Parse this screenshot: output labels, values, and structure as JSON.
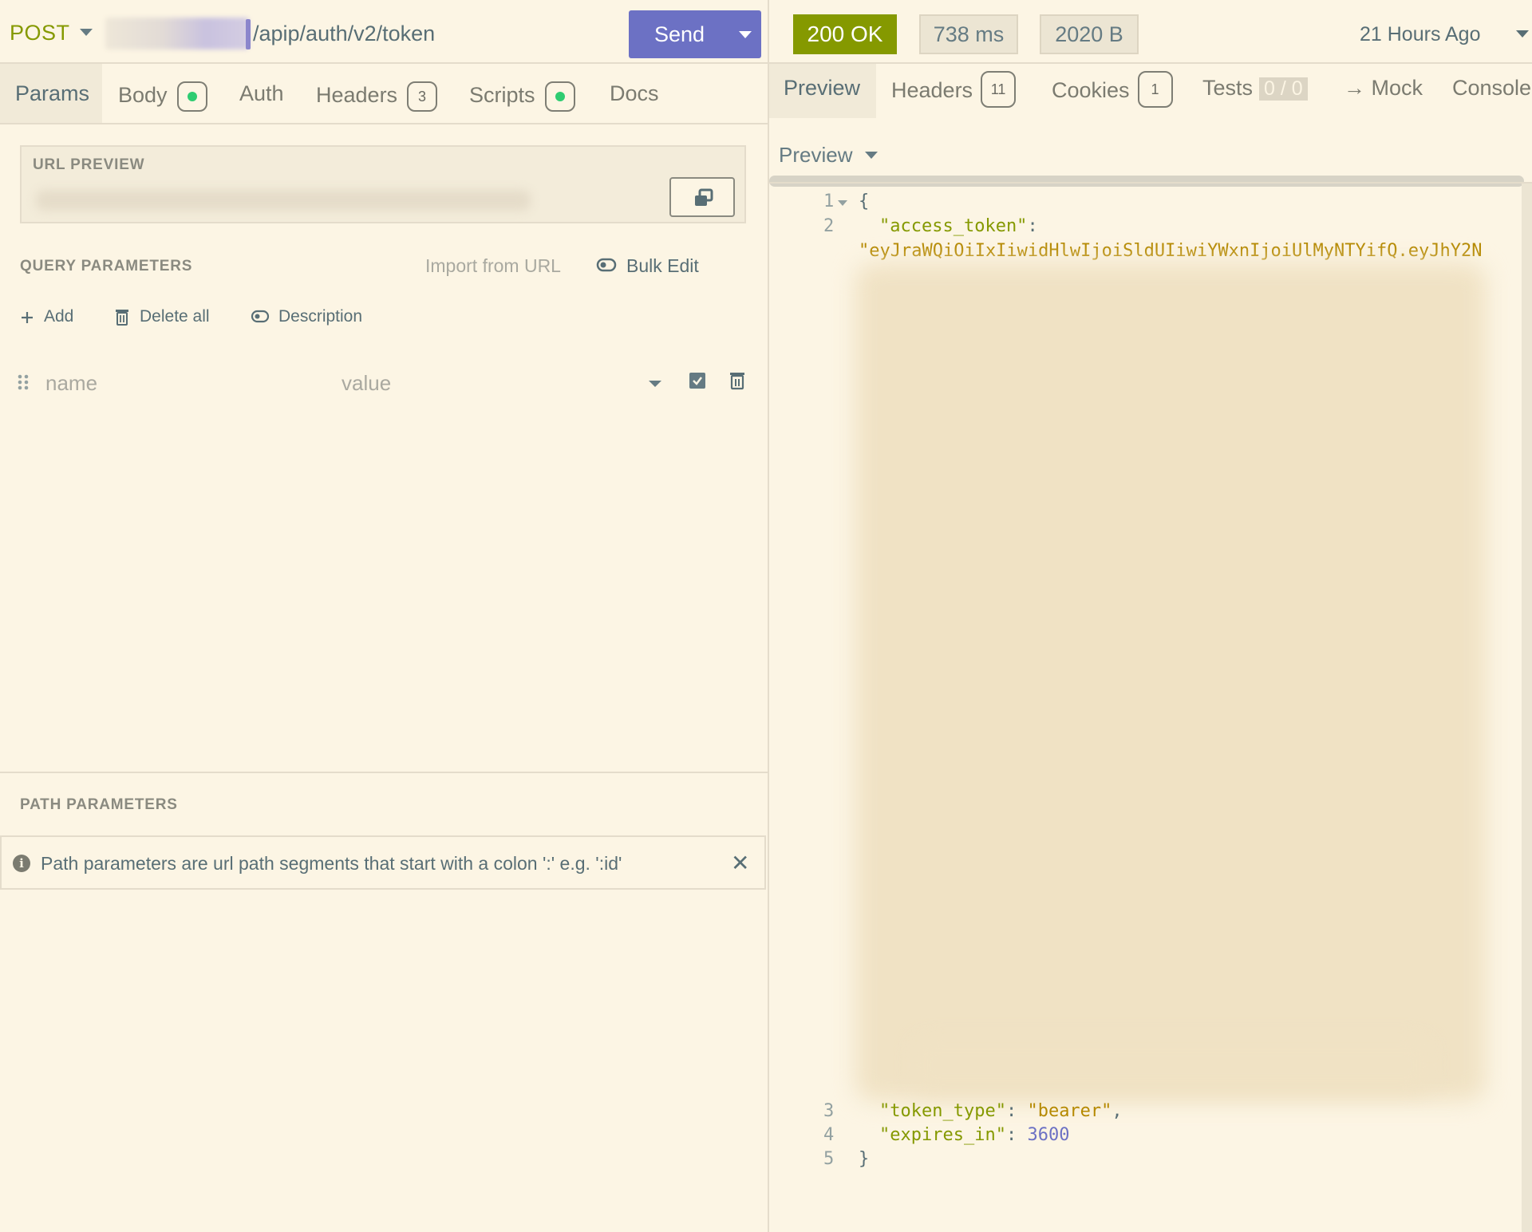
{
  "request": {
    "method": "POST",
    "url_path": "/apip/auth/v2/token",
    "send_label": "Send",
    "tabs": [
      {
        "label": "Params"
      },
      {
        "label": "Body"
      },
      {
        "label": "Auth"
      },
      {
        "label": "Headers",
        "badge": "3"
      },
      {
        "label": "Scripts"
      },
      {
        "label": "Docs"
      }
    ],
    "url_preview_label": "URL PREVIEW",
    "query_params_label": "QUERY PARAMETERS",
    "import_from_url": "Import from URL",
    "bulk_edit": "Bulk Edit",
    "actions": {
      "add": "Add",
      "delete_all": "Delete all",
      "description": "Description"
    },
    "param_row": {
      "name_placeholder": "name",
      "value_placeholder": "value"
    },
    "path_params_label": "PATH PARAMETERS",
    "path_params_info": "Path parameters are url path segments that start with a colon ':' e.g. ':id'"
  },
  "response": {
    "status": "200 OK",
    "time": "738 ms",
    "size": "2020 B",
    "time_ago": "21 Hours Ago",
    "tabs": [
      {
        "label": "Preview"
      },
      {
        "label": "Headers",
        "badge": "11"
      },
      {
        "label": "Cookies",
        "badge": "1"
      },
      {
        "label": "Tests",
        "score": "0 / 0"
      },
      {
        "label": "→ Mock"
      },
      {
        "label": "Console"
      }
    ],
    "preview_mode": "Preview",
    "code": {
      "line_numbers": [
        "1",
        "2",
        "3",
        "4",
        "5"
      ],
      "open_brace": "{",
      "access_token_key": "\"access_token\"",
      "colon": ":",
      "access_token_value": "\"eyJraWQiOiIxIiwidHlwIjoiSldUIiwiYWxnIjoiUlMyNTYifQ.eyJhY2N",
      "token_type_key": "\"token_type\"",
      "token_type_value": "\"bearer\"",
      "expires_in_key": "\"expires_in\"",
      "expires_in_value": "3600",
      "close_brace": "}"
    }
  },
  "colors": {
    "background": "#fcf5e4",
    "send_button": "#6c71c4",
    "status_ok": "#859900",
    "json_key": "#859900",
    "json_string": "#b58900",
    "json_number": "#6c71c4",
    "active_dot": "#2ecc71"
  }
}
